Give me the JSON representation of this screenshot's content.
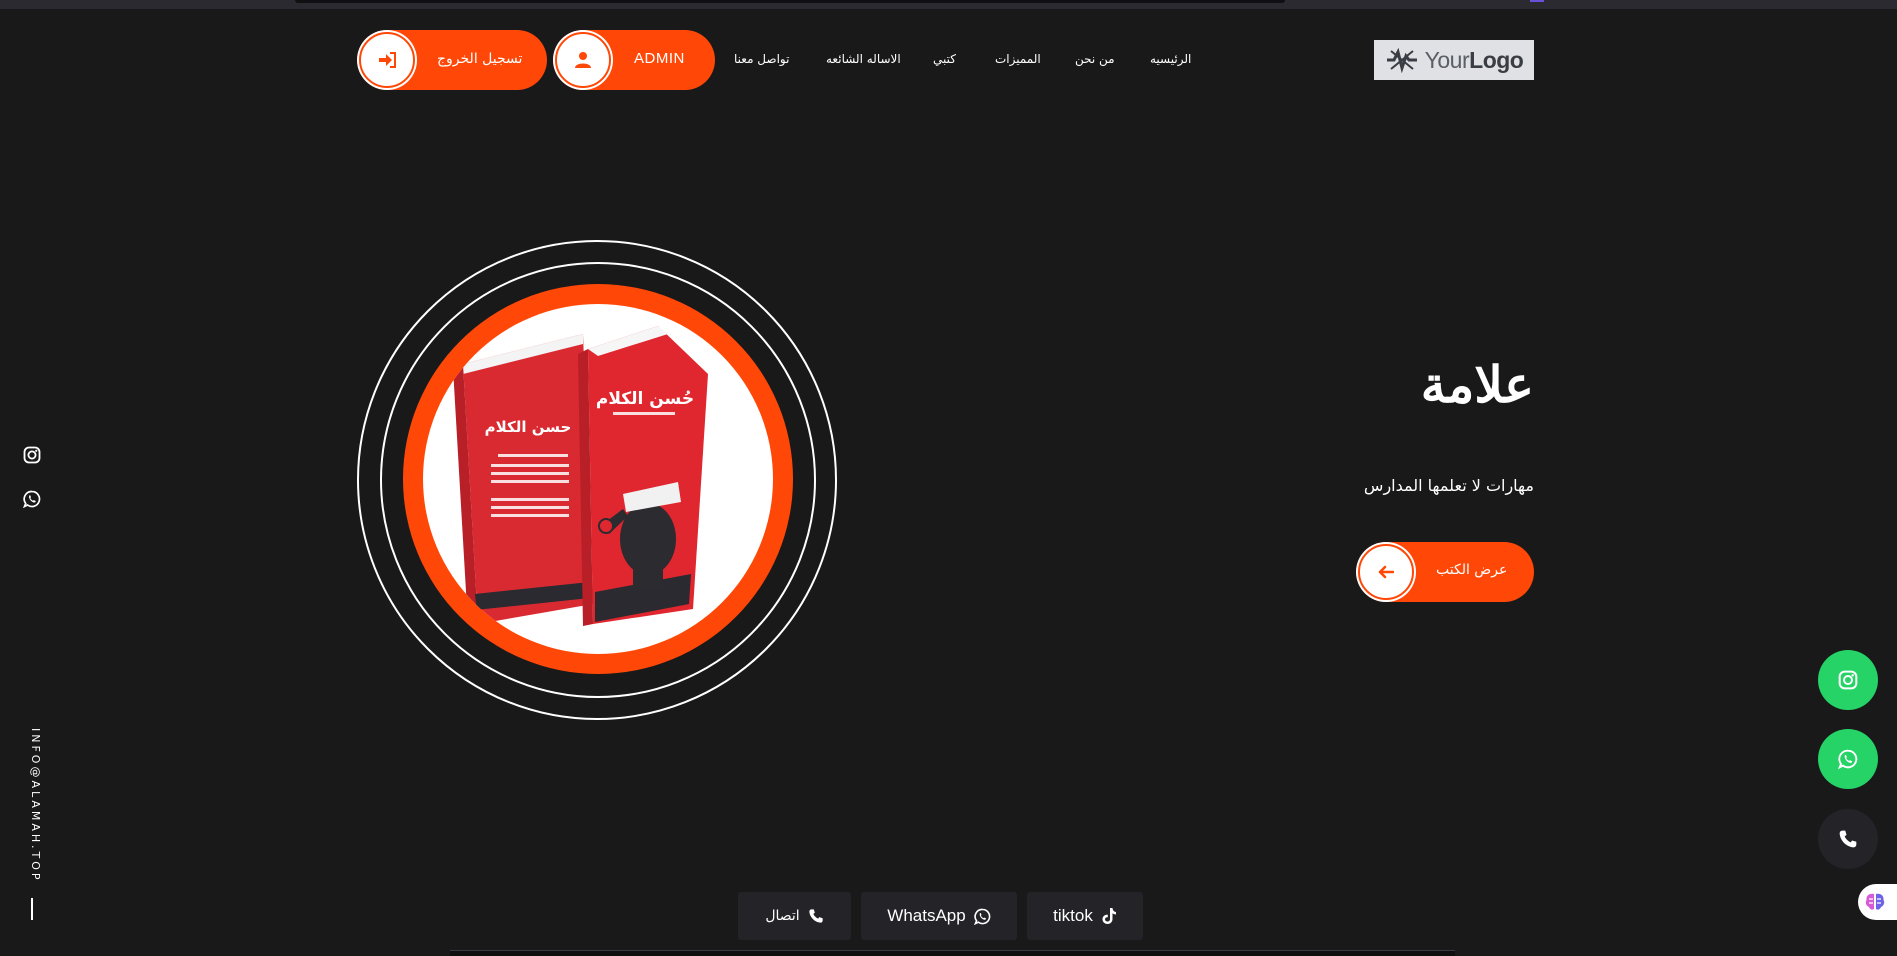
{
  "logo": {
    "text_light": "Your",
    "text_bold": "Logo"
  },
  "nav": {
    "items": [
      {
        "label": "الرئيسيه"
      },
      {
        "label": "من نحن"
      },
      {
        "label": "المميزات"
      },
      {
        "label": "كتبي"
      },
      {
        "label": "الاساله الشائعه"
      },
      {
        "label": "تواصل معنا"
      }
    ],
    "admin_label": "ADMIN",
    "logout_label": "تسجيل الخروج"
  },
  "hero": {
    "title": "علامة",
    "subtitle": "مهارات لا تعلمها المدارس",
    "cta_label": "عرض الكتب",
    "book_cover_title": "حُسن الكلام",
    "book_spine_title": "حسن الكلام"
  },
  "side": {
    "email": "INFO@ALAMAH.TOP"
  },
  "bottom_bar": {
    "call_label": "اتصال",
    "whatsapp_label": "WhatsApp",
    "tiktok_label": "tiktok"
  },
  "colors": {
    "accent": "#ff4808",
    "background": "#1a191a",
    "whatsapp_green": "#25d366",
    "dark_button": "#232328"
  },
  "icons": [
    "sign-in-icon",
    "user-icon",
    "arrow-left-icon",
    "instagram-icon",
    "whatsapp-icon",
    "phone-icon",
    "tiktok-icon",
    "brain-icon"
  ]
}
